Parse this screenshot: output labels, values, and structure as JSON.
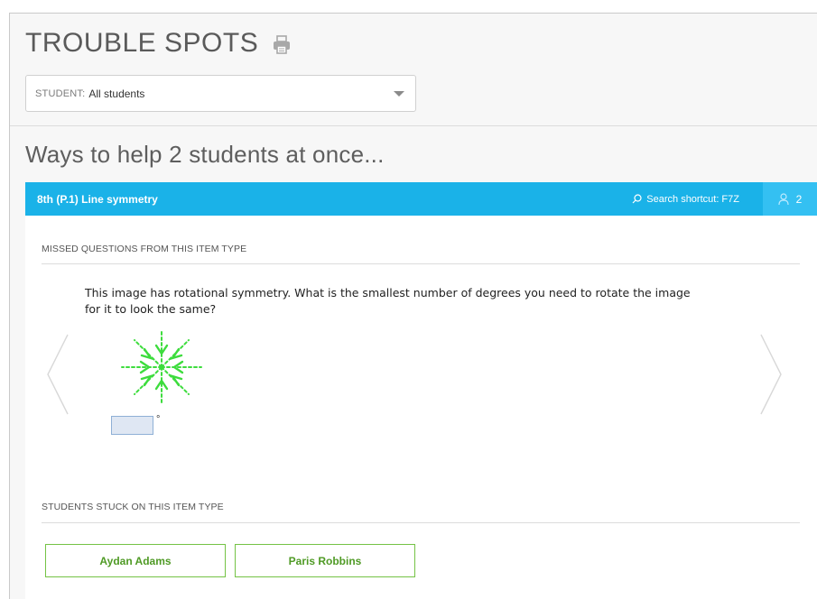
{
  "page": {
    "title": "TROUBLE SPOTS",
    "print_icon": "printer-icon"
  },
  "student_filter": {
    "prefix": "STUDENT:",
    "value": "All students",
    "caret_icon": "caret-down-icon"
  },
  "ways_heading": "Ways to help 2 students at once...",
  "item_bar": {
    "title": "8th (P.1)  Line symmetry",
    "search_icon": "search-icon",
    "search_shortcut": "Search shortcut: F7Z",
    "user_icon": "user-icon",
    "student_count": "2",
    "color": "#1ab2e8"
  },
  "missed_section": {
    "label": "MISSED QUESTIONS FROM THIS ITEM TYPE",
    "question": "This image has rotational symmetry. What is the smallest number of degrees you need to rotate the image for it to look the same?",
    "answer_value": "",
    "degree_symbol": "°",
    "prev_icon": "chevron-left-icon",
    "next_icon": "chevron-right-icon",
    "figure_color": "#3ddc3d"
  },
  "stuck_section": {
    "label": "STUDENTS STUCK ON THIS ITEM TYPE",
    "students": [
      {
        "name": "Aydan Adams"
      },
      {
        "name": "Paris Robbins"
      }
    ],
    "accent": "#74c345"
  }
}
